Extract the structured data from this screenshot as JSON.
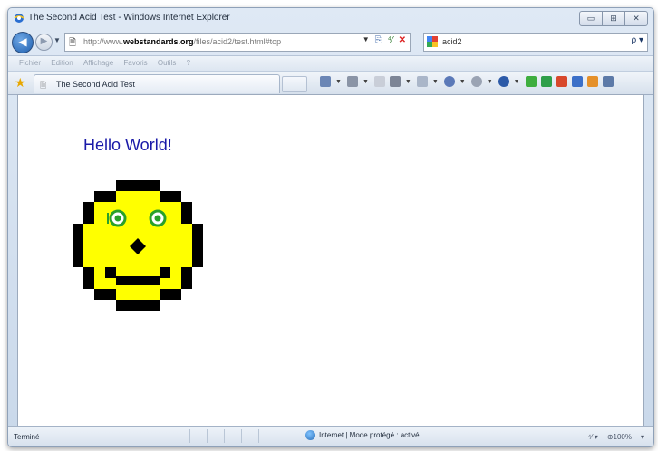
{
  "window": {
    "title": "The Second Acid Test - Windows Internet Explorer",
    "controls": [
      "▭",
      "⊞",
      "✕"
    ]
  },
  "nav": {
    "back": "◀",
    "forward": "▶",
    "dropdown": "▼",
    "address_value_prefix": "http://www.",
    "address_value_domain": "webstandards.org",
    "address_value_suffix": "/files/acid2/test.html#top",
    "address_tools": [
      "▼",
      "⎘",
      "⁴⁄",
      "✕"
    ]
  },
  "search": {
    "value": "acid2",
    "go": "ρ ▾"
  },
  "menu": {
    "items": [
      "Fichier",
      "Edition",
      "Affichage",
      "Favoris",
      "Outils",
      "?"
    ]
  },
  "tabs": {
    "active_label": "The Second Acid Test"
  },
  "page": {
    "heading": "Hello World!"
  },
  "status": {
    "left": "Terminé",
    "zone": "Internet | Mode protégé : activé",
    "zoom": "⊕100%",
    "zoom_caret": "▾",
    "security": "⁴⁄ ▾"
  },
  "colors": {
    "heading": "#1a1aa8",
    "face_fill": "#ffff00",
    "face_outline": "#000000",
    "eye_ring": "#2aa02a"
  }
}
